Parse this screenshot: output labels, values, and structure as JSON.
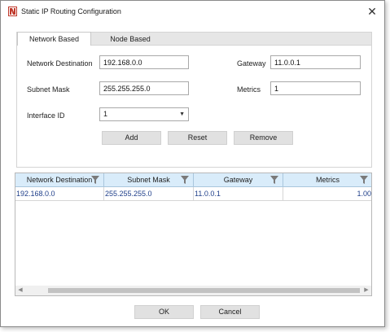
{
  "window": {
    "title": "Static IP Routing Configuration"
  },
  "tabs": [
    {
      "label": "Network Based",
      "active": true
    },
    {
      "label": "Node Based",
      "active": false
    }
  ],
  "form": {
    "network_destination": {
      "label": "Network Destination",
      "value": "192.168.0.0"
    },
    "subnet_mask": {
      "label": "Subnet Mask",
      "value": "255.255.255.0"
    },
    "interface_id": {
      "label": "Interface ID",
      "value": "1"
    },
    "gateway": {
      "label": "Gateway",
      "value": "11.0.0.1"
    },
    "metrics": {
      "label": "Metrics",
      "value": "1"
    }
  },
  "actions": {
    "add": "Add",
    "reset": "Reset",
    "remove": "Remove"
  },
  "table": {
    "columns": [
      "Network Destination",
      "Subnet Mask",
      "Gateway",
      "Metrics"
    ],
    "rows": [
      [
        "192.168.0.0",
        "255.255.255.0",
        "11.0.0.1",
        "1.00"
      ]
    ]
  },
  "footer": {
    "ok": "OK",
    "cancel": "Cancel"
  },
  "icons": {
    "app": "app-logo-icon",
    "close": "close-icon",
    "filter": "filter-icon",
    "dropdown": "chevron-down-icon"
  }
}
